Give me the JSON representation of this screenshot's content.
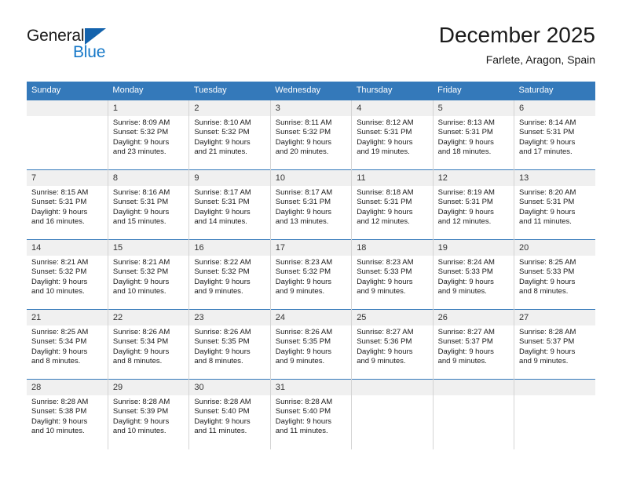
{
  "brand": {
    "name_top": "General",
    "name_bottom": "Blue"
  },
  "header": {
    "title": "December 2025",
    "subtitle": "Farlete, Aragon, Spain"
  },
  "colors": {
    "header_blue": "#3479ba",
    "logo_blue": "#1678c8",
    "daynum_band": "#f0f0f0",
    "cell_border": "#d4d4d4"
  },
  "weekdays": [
    "Sunday",
    "Monday",
    "Tuesday",
    "Wednesday",
    "Thursday",
    "Friday",
    "Saturday"
  ],
  "labels": {
    "sunrise_prefix": "Sunrise:",
    "sunset_prefix": "Sunset:",
    "daylight_prefix": "Daylight:"
  },
  "weeks": [
    [
      {
        "day": "",
        "sunrise": "",
        "sunset": "",
        "daylight_line1": "",
        "daylight_line2": ""
      },
      {
        "day": "1",
        "sunrise": "Sunrise: 8:09 AM",
        "sunset": "Sunset: 5:32 PM",
        "daylight_line1": "Daylight: 9 hours",
        "daylight_line2": "and 23 minutes."
      },
      {
        "day": "2",
        "sunrise": "Sunrise: 8:10 AM",
        "sunset": "Sunset: 5:32 PM",
        "daylight_line1": "Daylight: 9 hours",
        "daylight_line2": "and 21 minutes."
      },
      {
        "day": "3",
        "sunrise": "Sunrise: 8:11 AM",
        "sunset": "Sunset: 5:32 PM",
        "daylight_line1": "Daylight: 9 hours",
        "daylight_line2": "and 20 minutes."
      },
      {
        "day": "4",
        "sunrise": "Sunrise: 8:12 AM",
        "sunset": "Sunset: 5:31 PM",
        "daylight_line1": "Daylight: 9 hours",
        "daylight_line2": "and 19 minutes."
      },
      {
        "day": "5",
        "sunrise": "Sunrise: 8:13 AM",
        "sunset": "Sunset: 5:31 PM",
        "daylight_line1": "Daylight: 9 hours",
        "daylight_line2": "and 18 minutes."
      },
      {
        "day": "6",
        "sunrise": "Sunrise: 8:14 AM",
        "sunset": "Sunset: 5:31 PM",
        "daylight_line1": "Daylight: 9 hours",
        "daylight_line2": "and 17 minutes."
      }
    ],
    [
      {
        "day": "7",
        "sunrise": "Sunrise: 8:15 AM",
        "sunset": "Sunset: 5:31 PM",
        "daylight_line1": "Daylight: 9 hours",
        "daylight_line2": "and 16 minutes."
      },
      {
        "day": "8",
        "sunrise": "Sunrise: 8:16 AM",
        "sunset": "Sunset: 5:31 PM",
        "daylight_line1": "Daylight: 9 hours",
        "daylight_line2": "and 15 minutes."
      },
      {
        "day": "9",
        "sunrise": "Sunrise: 8:17 AM",
        "sunset": "Sunset: 5:31 PM",
        "daylight_line1": "Daylight: 9 hours",
        "daylight_line2": "and 14 minutes."
      },
      {
        "day": "10",
        "sunrise": "Sunrise: 8:17 AM",
        "sunset": "Sunset: 5:31 PM",
        "daylight_line1": "Daylight: 9 hours",
        "daylight_line2": "and 13 minutes."
      },
      {
        "day": "11",
        "sunrise": "Sunrise: 8:18 AM",
        "sunset": "Sunset: 5:31 PM",
        "daylight_line1": "Daylight: 9 hours",
        "daylight_line2": "and 12 minutes."
      },
      {
        "day": "12",
        "sunrise": "Sunrise: 8:19 AM",
        "sunset": "Sunset: 5:31 PM",
        "daylight_line1": "Daylight: 9 hours",
        "daylight_line2": "and 12 minutes."
      },
      {
        "day": "13",
        "sunrise": "Sunrise: 8:20 AM",
        "sunset": "Sunset: 5:31 PM",
        "daylight_line1": "Daylight: 9 hours",
        "daylight_line2": "and 11 minutes."
      }
    ],
    [
      {
        "day": "14",
        "sunrise": "Sunrise: 8:21 AM",
        "sunset": "Sunset: 5:32 PM",
        "daylight_line1": "Daylight: 9 hours",
        "daylight_line2": "and 10 minutes."
      },
      {
        "day": "15",
        "sunrise": "Sunrise: 8:21 AM",
        "sunset": "Sunset: 5:32 PM",
        "daylight_line1": "Daylight: 9 hours",
        "daylight_line2": "and 10 minutes."
      },
      {
        "day": "16",
        "sunrise": "Sunrise: 8:22 AM",
        "sunset": "Sunset: 5:32 PM",
        "daylight_line1": "Daylight: 9 hours",
        "daylight_line2": "and 9 minutes."
      },
      {
        "day": "17",
        "sunrise": "Sunrise: 8:23 AM",
        "sunset": "Sunset: 5:32 PM",
        "daylight_line1": "Daylight: 9 hours",
        "daylight_line2": "and 9 minutes."
      },
      {
        "day": "18",
        "sunrise": "Sunrise: 8:23 AM",
        "sunset": "Sunset: 5:33 PM",
        "daylight_line1": "Daylight: 9 hours",
        "daylight_line2": "and 9 minutes."
      },
      {
        "day": "19",
        "sunrise": "Sunrise: 8:24 AM",
        "sunset": "Sunset: 5:33 PM",
        "daylight_line1": "Daylight: 9 hours",
        "daylight_line2": "and 9 minutes."
      },
      {
        "day": "20",
        "sunrise": "Sunrise: 8:25 AM",
        "sunset": "Sunset: 5:33 PM",
        "daylight_line1": "Daylight: 9 hours",
        "daylight_line2": "and 8 minutes."
      }
    ],
    [
      {
        "day": "21",
        "sunrise": "Sunrise: 8:25 AM",
        "sunset": "Sunset: 5:34 PM",
        "daylight_line1": "Daylight: 9 hours",
        "daylight_line2": "and 8 minutes."
      },
      {
        "day": "22",
        "sunrise": "Sunrise: 8:26 AM",
        "sunset": "Sunset: 5:34 PM",
        "daylight_line1": "Daylight: 9 hours",
        "daylight_line2": "and 8 minutes."
      },
      {
        "day": "23",
        "sunrise": "Sunrise: 8:26 AM",
        "sunset": "Sunset: 5:35 PM",
        "daylight_line1": "Daylight: 9 hours",
        "daylight_line2": "and 8 minutes."
      },
      {
        "day": "24",
        "sunrise": "Sunrise: 8:26 AM",
        "sunset": "Sunset: 5:35 PM",
        "daylight_line1": "Daylight: 9 hours",
        "daylight_line2": "and 9 minutes."
      },
      {
        "day": "25",
        "sunrise": "Sunrise: 8:27 AM",
        "sunset": "Sunset: 5:36 PM",
        "daylight_line1": "Daylight: 9 hours",
        "daylight_line2": "and 9 minutes."
      },
      {
        "day": "26",
        "sunrise": "Sunrise: 8:27 AM",
        "sunset": "Sunset: 5:37 PM",
        "daylight_line1": "Daylight: 9 hours",
        "daylight_line2": "and 9 minutes."
      },
      {
        "day": "27",
        "sunrise": "Sunrise: 8:28 AM",
        "sunset": "Sunset: 5:37 PM",
        "daylight_line1": "Daylight: 9 hours",
        "daylight_line2": "and 9 minutes."
      }
    ],
    [
      {
        "day": "28",
        "sunrise": "Sunrise: 8:28 AM",
        "sunset": "Sunset: 5:38 PM",
        "daylight_line1": "Daylight: 9 hours",
        "daylight_line2": "and 10 minutes."
      },
      {
        "day": "29",
        "sunrise": "Sunrise: 8:28 AM",
        "sunset": "Sunset: 5:39 PM",
        "daylight_line1": "Daylight: 9 hours",
        "daylight_line2": "and 10 minutes."
      },
      {
        "day": "30",
        "sunrise": "Sunrise: 8:28 AM",
        "sunset": "Sunset: 5:40 PM",
        "daylight_line1": "Daylight: 9 hours",
        "daylight_line2": "and 11 minutes."
      },
      {
        "day": "31",
        "sunrise": "Sunrise: 8:28 AM",
        "sunset": "Sunset: 5:40 PM",
        "daylight_line1": "Daylight: 9 hours",
        "daylight_line2": "and 11 minutes."
      },
      {
        "day": "",
        "sunrise": "",
        "sunset": "",
        "daylight_line1": "",
        "daylight_line2": ""
      },
      {
        "day": "",
        "sunrise": "",
        "sunset": "",
        "daylight_line1": "",
        "daylight_line2": ""
      },
      {
        "day": "",
        "sunrise": "",
        "sunset": "",
        "daylight_line1": "",
        "daylight_line2": ""
      }
    ]
  ]
}
